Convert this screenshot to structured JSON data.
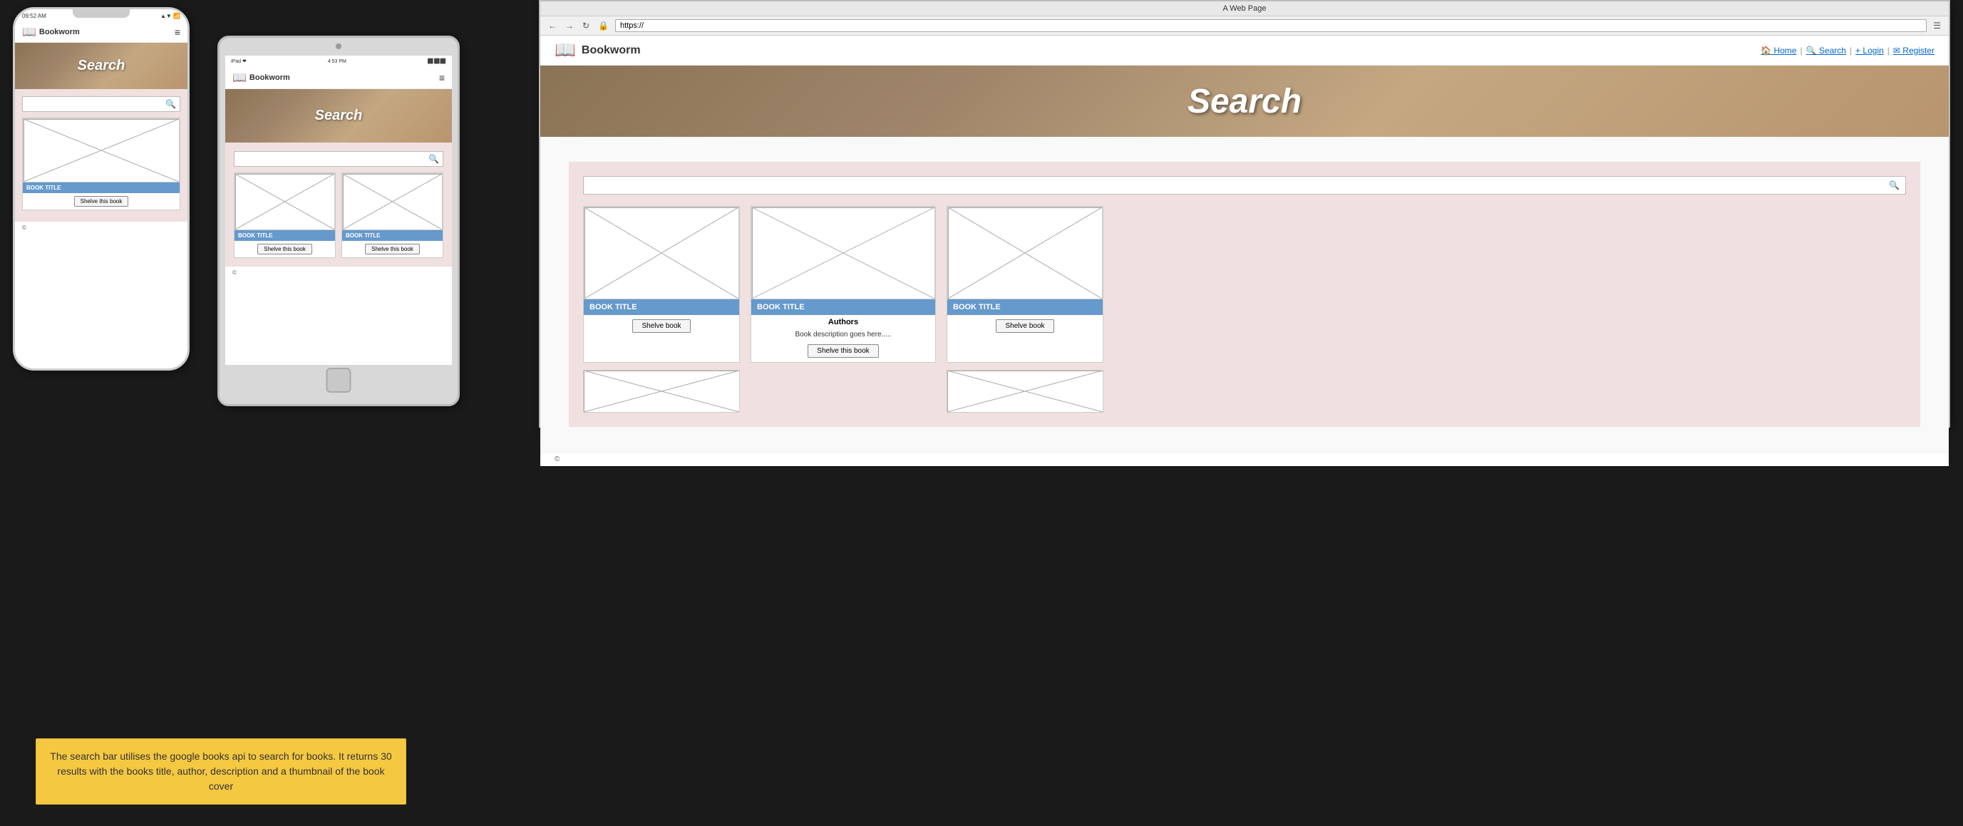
{
  "phone": {
    "status_time": "09:52 AM",
    "status_signal": "▲▼ WiFi ⬛",
    "brand": "Bookworm",
    "hamburger": "≡",
    "hero_text": "Search",
    "search_placeholder": "",
    "search_icon": "🔍",
    "book_title": "BOOK TITLE",
    "shelve_label": "Shelve this book",
    "footer_copyright": "©"
  },
  "tablet": {
    "status_left": "iPad ❤",
    "status_time": "4:53 PM",
    "status_right": "⬛⬛⬛",
    "brand": "Bookworm",
    "hamburger": "≡",
    "hero_text": "Search",
    "search_placeholder": "",
    "search_icon": "🔍",
    "book_title_1": "BOOK TITLE",
    "book_title_2": "BOOK TITLE",
    "shelve_label_1": "Shelve this book",
    "shelve_label_2": "Shelve this book",
    "footer_copyright": "©"
  },
  "browser": {
    "window_title": "A Web Page",
    "address": "https://",
    "nav_home": "🏠 Home",
    "nav_search": "🔍 Search",
    "nav_login": "+ Login",
    "nav_register": "✉ Register",
    "brand": "Bookworm",
    "hero_text": "Search",
    "search_placeholder": "",
    "search_icon": "🔍",
    "book1_title": "BOOK TITLE",
    "book2_title": "BOOK TITLE",
    "book3_title": "BOOK TITLE",
    "book2_authors": "Authors",
    "book2_description": "Book description goes here.....",
    "shelve_label_1": "Shelve book",
    "shelve_label_2": "Shelve this book",
    "shelve_label_3": "Shelve book",
    "footer_copyright": "©"
  },
  "info_box": {
    "text": "The search bar utilises the google books api to search for books. It returns 30 results with the books title, author, description and a thumbnail of the book cover"
  }
}
